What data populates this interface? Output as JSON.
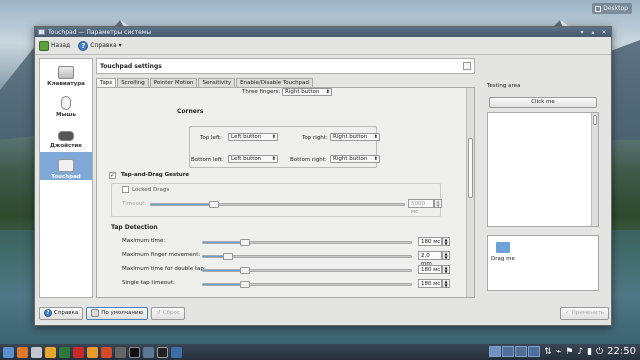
{
  "desktop": {
    "label": "Desktop"
  },
  "window": {
    "title": "Touchpad — Параметры системы"
  },
  "toolbar": {
    "back": "Назад",
    "help": "Справка"
  },
  "sidebar": {
    "items": [
      {
        "label": "Клавиатура",
        "icon": "keyboard-icon"
      },
      {
        "label": "Мышь",
        "icon": "mouse-icon"
      },
      {
        "label": "Джойстик",
        "icon": "joystick-icon"
      },
      {
        "label": "Touchpad",
        "icon": "touchpad-icon",
        "active": true
      }
    ]
  },
  "panel": {
    "title": "Touchpad settings"
  },
  "tabs": [
    "Taps",
    "Scrolling",
    "Pointer Motion",
    "Sensitivity",
    "Enable/Disable Touchpad"
  ],
  "taps": {
    "three_fingers_label": "Three fingers:",
    "three_fingers_value": "Right button",
    "corners_title": "Corners",
    "top_left_label": "Top left:",
    "top_left_value": "Left button",
    "top_right_label": "Top right:",
    "top_right_value": "Right button",
    "bottom_left_label": "Bottom left:",
    "bottom_left_value": "Left button",
    "bottom_right_label": "Bottom right:",
    "bottom_right_value": "Right button",
    "tap_drag_label": "Tap-and-Drag Gesture",
    "tap_drag_checked": true,
    "locked_drags_label": "Locked Drags",
    "locked_drags_checked": false,
    "timeout_label": "Timeout:",
    "timeout_value": "5000 мс",
    "timeout_level": 0.25,
    "detection_title": "Tap Detection",
    "max_time_label": "Maximum time:",
    "max_time_value": "180 мс",
    "max_time_level": 0.2,
    "max_move_label": "Maximum finger movement:",
    "max_move_value": "2,0 mm",
    "max_move_level": 0.12,
    "double_label": "Maximum time for double tap:",
    "double_value": "180 мс",
    "double_level": 0.2,
    "single_label": "Single tap timeout:",
    "single_value": "180 мс",
    "single_level": 0.2
  },
  "testing": {
    "title": "Testing area",
    "click_me": "Click me",
    "drag_me": "Drag me"
  },
  "bottom": {
    "help": "Справка",
    "defaults": "По умолчанию",
    "reset": "Сброс",
    "apply": "Применить"
  },
  "clock": "22:50",
  "colors": {
    "accent": "#7fa8d6",
    "slider_fill": "#6d9ad1"
  }
}
